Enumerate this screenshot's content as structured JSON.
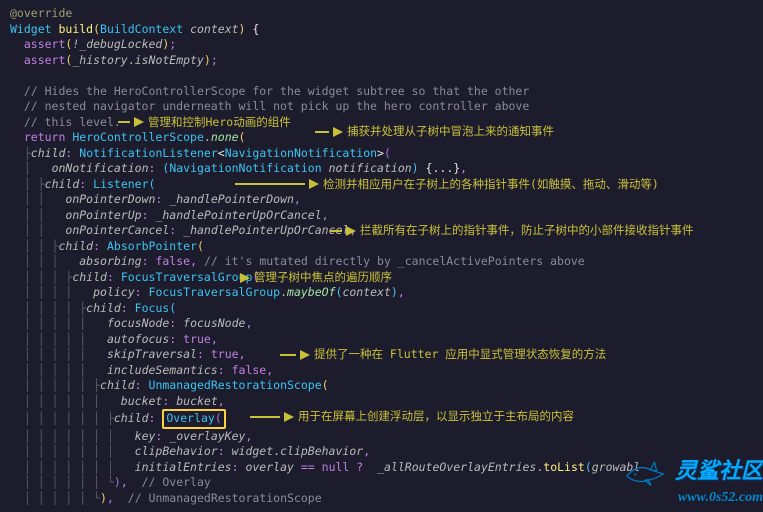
{
  "code": {
    "annotation": "@override",
    "sig_type": "Widget",
    "sig_method": "build",
    "sig_param_type": "BuildContext",
    "sig_param_name": "context",
    "assert1_a": "assert",
    "assert1_b": "!_debugLocked",
    "assert2_a": "assert",
    "assert2_b": "_history",
    "assert2_c": "isNotEmpty",
    "comment1": "// Hides the HeroControllerScope for the widget subtree so that the other",
    "comment2": "// nested navigator underneath will not pick up the hero controller above",
    "comment3": "// this level.",
    "return_kw": "return",
    "hcs": "HeroControllerScope",
    "none": "none",
    "child": "child",
    "nl": "NotificationListener",
    "nn": "NavigationNotification",
    "onNotification": "onNotification",
    "nn2": "NavigationNotification",
    "notification": "notification",
    "lambda_body": "{...}",
    "listener": "Listener",
    "onPointerDown": "onPointerDown",
    "hpd": "_handlePointerDown",
    "onPointerUp": "onPointerUp",
    "hpu": "_handlePointerUpOrCancel",
    "onPointerCancel": "onPointerCancel",
    "hpc": "_handlePointerUpOrCancel",
    "absorbPointer": "AbsorbPointer",
    "absorbing": "absorbing",
    "falseVal": "false",
    "absorb_comment": "// it's mutated directly by _cancelActivePointers above",
    "ftg": "FocusTraversalGroup",
    "policy": "policy",
    "ftg2": "FocusTraversalGroup",
    "maybeOf": "maybeOf",
    "context2": "context",
    "focus": "Focus",
    "focusNode": "focusNode",
    "focusNodeVal": "focusNode",
    "autofocus": "autofocus",
    "trueVal": "true",
    "skipTraversal": "skipTraversal",
    "includeSemantics": "includeSemantics",
    "urs": "UnmanagedRestorationScope",
    "bucket": "bucket",
    "bucketVal": "bucket",
    "overlay": "Overlay",
    "key": "key",
    "overlayKey": "_overlayKey",
    "clipBehavior": "clipBehavior",
    "widget": "widget",
    "clipBehavior2": "clipBehavior",
    "initialEntries": "initialEntries",
    "overlayVar": "overlay",
    "nullVal": "null",
    "allRoute": "_allRouteOverlayEntries",
    "toList": "toList",
    "growable": "growabl",
    "close_overlay": "// Overlay",
    "close_urs": "// UnmanagedRestorationScope"
  },
  "annotations": {
    "a1": "管理和控制Hero动画的组件",
    "a2": "捕获并处理从子树中冒泡上来的通知事件",
    "a3": "检测并相应用户在子树上的各种指针事件(如触摸、拖动、滑动等)",
    "a4": "拦截所有在子树上的指针事件，防止子树中的小部件接收指针事件",
    "a5": "管理子树中焦点的遍历顺序",
    "a6": "提供了一种在 Flutter 应用中显式管理状态恢复的方法",
    "a7": "用于在屏幕上创建浮动层，以显示独立于主布局的内容"
  },
  "watermark": {
    "brand": "灵鲨社区",
    "url": "www.0s52.com"
  }
}
